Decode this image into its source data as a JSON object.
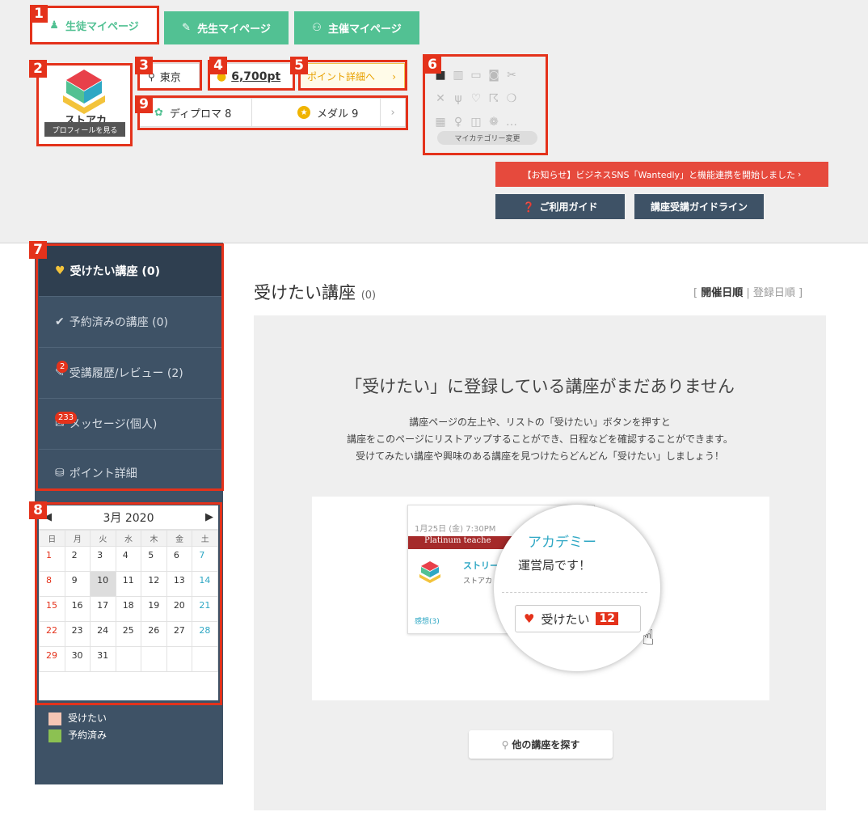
{
  "tabs": [
    {
      "label": "生徒マイページ",
      "icon": "student-icon"
    },
    {
      "label": "先生マイページ",
      "icon": "teacher-icon"
    },
    {
      "label": "主催マイページ",
      "icon": "group-icon"
    }
  ],
  "markers": [
    "1",
    "2",
    "3",
    "4",
    "5",
    "6",
    "7",
    "8",
    "9"
  ],
  "profile": {
    "logo_text": "ストアカ",
    "button": "プロフィールを見る"
  },
  "location": "東京",
  "points": "6,700pt",
  "point_detail": "ポイント詳細へ",
  "diploma": "ディプロマ 8",
  "medal": "メダル 9",
  "category_button": "マイカテゴリー変更",
  "notice": "【お知らせ】ビジネスSNS「Wantedly」と機能連携を開始しました",
  "guide_button": "ご利用ガイド",
  "guideline_button": "講座受講ガイドライン",
  "sidebar": {
    "items": [
      {
        "label": "受けたい講座 (0)",
        "icon": "heart-icon"
      },
      {
        "label": "予約済みの講座 (0)",
        "icon": "check-icon"
      },
      {
        "label": "受講履歴/レビュー (2)",
        "icon": "review-icon",
        "badge": "2"
      },
      {
        "label": "メッセージ(個人)",
        "icon": "mail-icon",
        "badge": "233"
      },
      {
        "label": "ポイント詳細",
        "icon": "coin-icon"
      }
    ]
  },
  "calendar": {
    "title": "3月 2020",
    "weekdays": [
      "日",
      "月",
      "火",
      "水",
      "木",
      "金",
      "土"
    ],
    "weeks": [
      [
        "1",
        "2",
        "3",
        "4",
        "5",
        "6",
        "7"
      ],
      [
        "8",
        "9",
        "10",
        "11",
        "12",
        "13",
        "14"
      ],
      [
        "15",
        "16",
        "17",
        "18",
        "19",
        "20",
        "21"
      ],
      [
        "22",
        "23",
        "24",
        "25",
        "26",
        "27",
        "28"
      ],
      [
        "29",
        "30",
        "31",
        "",
        "",
        "",
        ""
      ]
    ]
  },
  "legend": [
    {
      "label": "受けたい",
      "color": "#f5c6b4"
    },
    {
      "label": "予約済み",
      "color": "#8cc152"
    }
  ],
  "main": {
    "title": "受けたい講座",
    "count": "(0)",
    "sort_active": "開催日順",
    "sort_other": "登録日順",
    "empty_title": "「受けたい」に登録している講座がまだありません",
    "desc": [
      "講座ページの左上や、リストの「受けたい」ボタンを押すと",
      "講座をこのページにリストアップすることができ、日程などを確認することができます。",
      "受けてみたい講座や興味のある講座を見つけたらどんどん「受けたい」しましょう！"
    ],
    "illus": {
      "date": "1月25日 (金) 7:30PM",
      "platinum": "Platinum teache",
      "academy": "アカデミー",
      "course": "ストリー",
      "office": "運営局です！",
      "sub": "ストアカ",
      "review": "感想(3)",
      "want": "受けたい",
      "want_count": "12"
    },
    "search_button": "他の講座を探す"
  }
}
